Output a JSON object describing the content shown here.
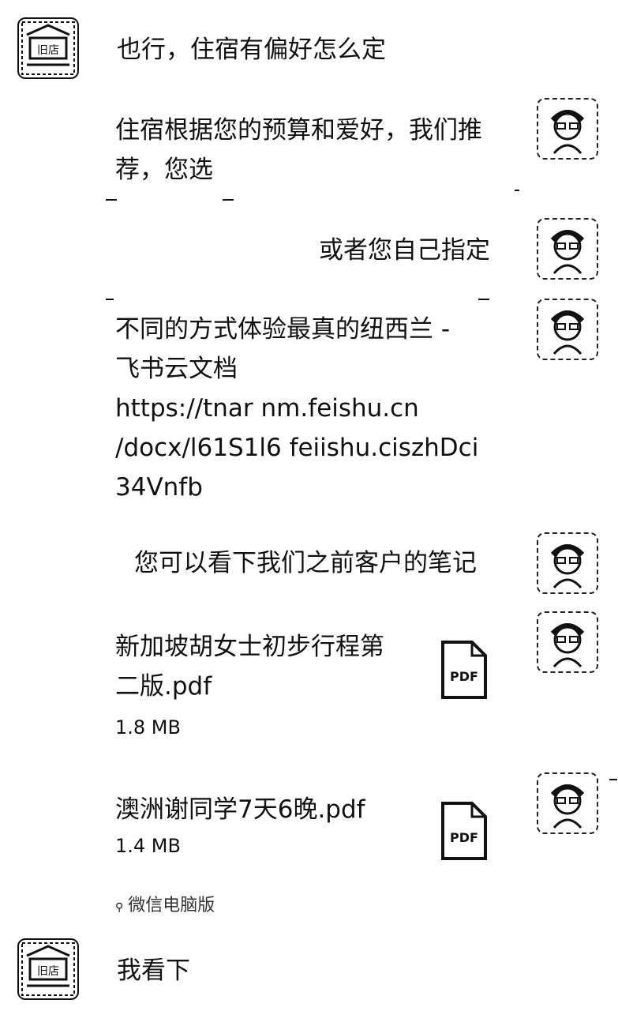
{
  "messages": [
    {
      "id": "m1",
      "side": "left",
      "text": "也行，住宿有偏好怎么定"
    },
    {
      "id": "m2",
      "side": "right",
      "lines": [
        "住宿根据您的预算和爱好，我们推",
        "荐，您选"
      ]
    },
    {
      "id": "m3",
      "side": "right",
      "text": "或者您自己指定"
    },
    {
      "id": "m4",
      "side": "right",
      "lines": [
        "不同的方式体验最真的纽西兰 -",
        "飞书云文档",
        "https://tnar     nm.feishu.cn",
        "/docx/l61S1l6 feiishu.ciszhDci",
        "34Vnfb"
      ]
    },
    {
      "id": "m5",
      "side": "right",
      "text": "您可以看下我们之前客户的笔记"
    },
    {
      "id": "m8",
      "side": "left",
      "text": "我看下"
    }
  ],
  "files": [
    {
      "name_lines": [
        "新加坡胡女士初步行程第",
        "二版.pdf"
      ],
      "size": "1.8 MB",
      "icon_label": "PDF"
    },
    {
      "name_lines": [
        "澳洲谢同学7天6晚.pdf"
      ],
      "size": "1.4 MB",
      "icon_label": "PDF"
    }
  ],
  "source_label": "微信电脑版",
  "avatars": {
    "left": "user-avatar",
    "right": "agent-avatar"
  }
}
